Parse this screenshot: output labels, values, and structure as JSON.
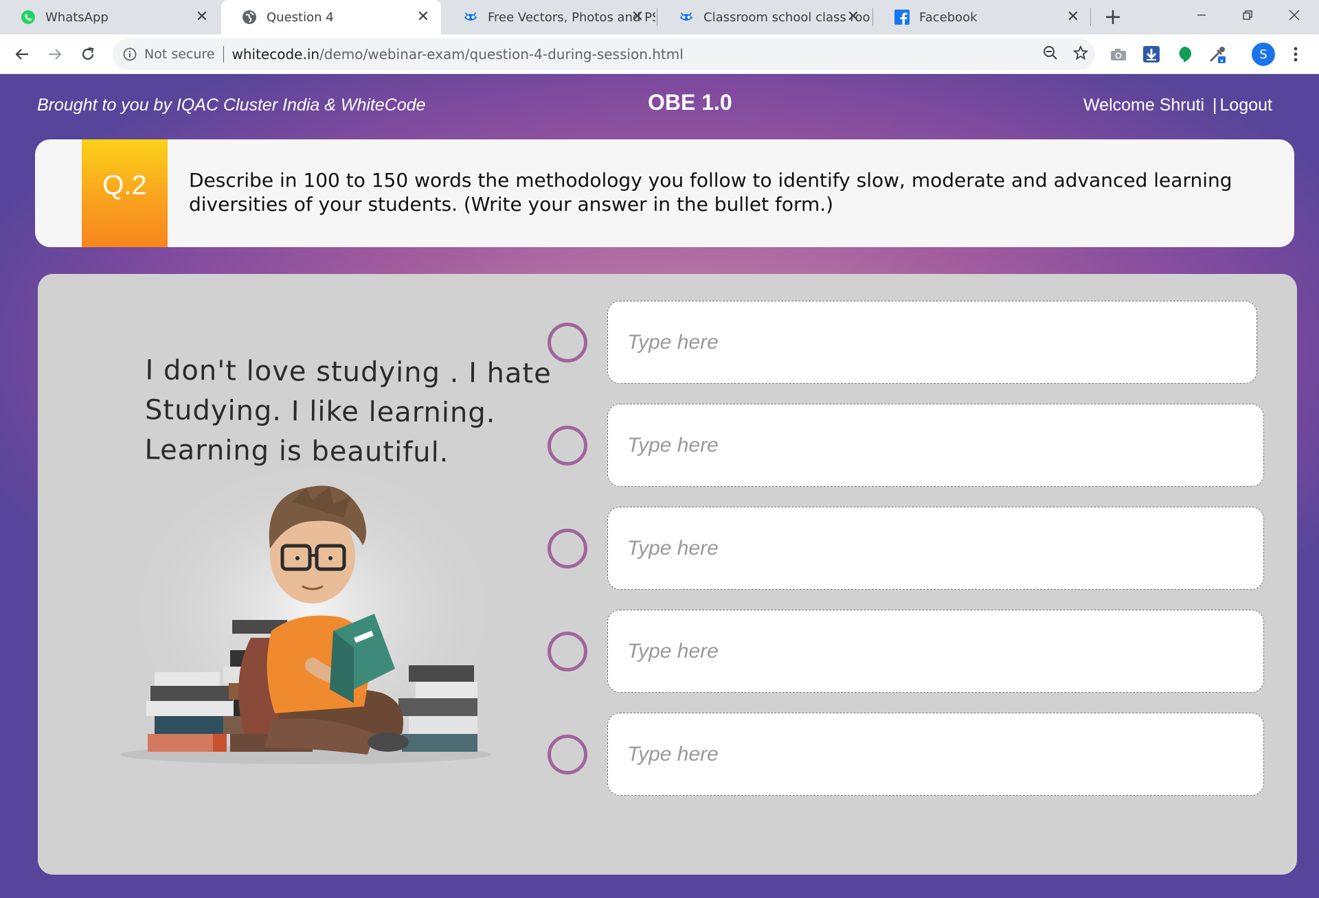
{
  "browser": {
    "tabs": [
      {
        "title": "WhatsApp",
        "icon": "whatsapp-icon",
        "active": false
      },
      {
        "title": "Question 4",
        "icon": "globe-icon",
        "active": true
      },
      {
        "title": "Free Vectors, Photos and PS",
        "icon": "freepik-icon",
        "active": false
      },
      {
        "title": "Classroom school class roo",
        "icon": "freepik-icon",
        "active": false
      },
      {
        "title": "Facebook",
        "icon": "facebook-icon",
        "active": false
      }
    ],
    "security_label": "Not secure",
    "url_host": "whitecode.in",
    "url_path": "/demo/webinar-exam/question-4-during-session.html",
    "profile_initial": "S"
  },
  "header": {
    "brand": "Brought to you by IQAC Cluster India  & WhiteCode",
    "title": "OBE 1.0",
    "welcome": "Welcome Shruti",
    "separator": "|",
    "logout": "Logout"
  },
  "question": {
    "number": "Q.2",
    "text": "Describe in 100 to 150 words the methodology you follow to identify slow, moderate and advanced learning diversities of your students. (Write your answer in the bullet form.)"
  },
  "illustration": {
    "quote_lines": [
      "I don't  love  studying . I hate",
      "Studying. I like learning.",
      "Learning  is  beautiful."
    ]
  },
  "answers": {
    "placeholders": [
      "Type here",
      "Type here",
      "Type here",
      "Type here",
      "Type here"
    ]
  },
  "colors": {
    "accent_purple": "#a0659d",
    "badge_orange": "#f7861e",
    "badge_yellow": "#fbd219"
  }
}
